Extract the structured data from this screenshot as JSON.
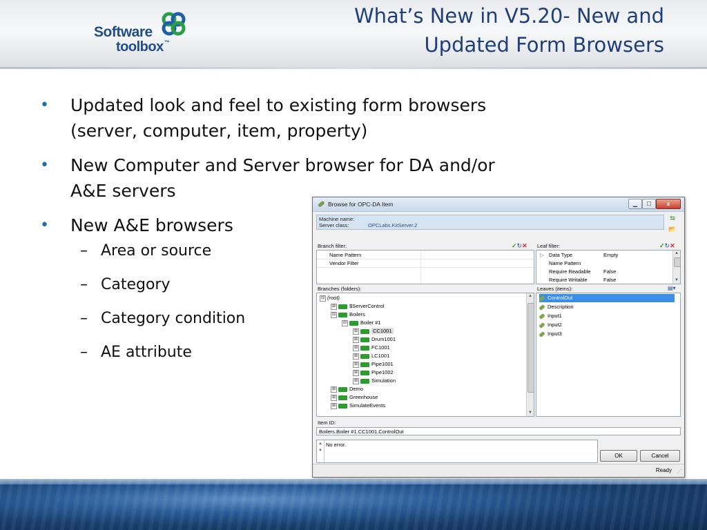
{
  "slide": {
    "title_line1": "What’s New in V5.20- New and",
    "title_line2": "Updated Form Browsers",
    "logo": {
      "line1": "Software",
      "line2": "toolbox",
      "tm": "™"
    },
    "bullets": [
      {
        "line1": "Updated look and feel to existing form browsers",
        "line2": "(server, computer, item, property)"
      },
      {
        "line1": "New Computer and Server browser for DA and/or",
        "line2": "A&E servers"
      },
      {
        "line1": "New A&E browsers",
        "line2": ""
      }
    ],
    "sub_bullets": [
      "Area or source",
      "Category",
      "Category condition",
      "AE attribute"
    ],
    "bullet_glyph": "•",
    "dash_glyph": "–",
    "colors": {
      "title": "#1f3f7a",
      "bullet": "#1b6fa8",
      "logo": "#1e4d8a"
    }
  },
  "dialog": {
    "title": "Browse for OPC-DA Item",
    "window_buttons": {
      "minimize": "▁",
      "maximize": "☐",
      "close": "x"
    },
    "machine_label": "Machine name:",
    "machine_value": "",
    "server_label": "Server class:",
    "server_value": "OPCLabs.KitServer.2",
    "branch_filter_label": "Branch filter:",
    "branch_filter_rows": [
      "Name Pattern",
      "Vendor Filter"
    ],
    "leaf_filter_label": "Leaf filter:",
    "leaf_filter_rows": [
      {
        "name": "Data Type",
        "value": "Empty"
      },
      {
        "name": "Name Pattern",
        "value": ""
      },
      {
        "name": "Require Readable",
        "value": "False"
      },
      {
        "name": "Require Writable",
        "value": "False"
      }
    ],
    "branches_label": "Branches (folders):",
    "tree": [
      {
        "label": "(root)",
        "exp": "⊟",
        "folder": false,
        "italic": true
      },
      {
        "label": "$ServerControl",
        "exp": "⊞",
        "folder": true
      },
      {
        "label": "Boilers",
        "exp": "⊟",
        "folder": true
      },
      {
        "label": "Boiler #1",
        "exp": "⊟",
        "folder": true
      },
      {
        "label": "CC1001",
        "exp": "⊞",
        "folder": true,
        "selected": true
      },
      {
        "label": "Drum1001",
        "exp": "⊞",
        "folder": true
      },
      {
        "label": "FC1001",
        "exp": "⊞",
        "folder": true
      },
      {
        "label": "LC1001",
        "exp": "⊞",
        "folder": true
      },
      {
        "label": "Pipe1001",
        "exp": "⊞",
        "folder": true
      },
      {
        "label": "Pipe1002",
        "exp": "⊞",
        "folder": true
      },
      {
        "label": "Simulation",
        "exp": "⊞",
        "folder": true
      },
      {
        "label": "Demo",
        "exp": "⊞",
        "folder": true
      },
      {
        "label": "Greenhouse",
        "exp": "⊞",
        "folder": true
      },
      {
        "label": "SimulateEvents",
        "exp": "⊞",
        "folder": true
      }
    ],
    "leaves_label": "Leaves (items):",
    "leaves": [
      "ControlOut",
      "Description",
      "Input1",
      "Input2",
      "Input3"
    ],
    "item_id_label": "Item ID:",
    "item_id_value": "Boilers.Boiler #1.CC1001.ControlOut",
    "error_text": "No error.",
    "ok_label": "OK",
    "cancel_label": "Cancel",
    "status": "Ready",
    "icons": {
      "check": "✓",
      "refresh": "↻",
      "clear": "✕",
      "swap": "⇆",
      "folder_up": "📂",
      "view_menu": "▤▾"
    }
  }
}
